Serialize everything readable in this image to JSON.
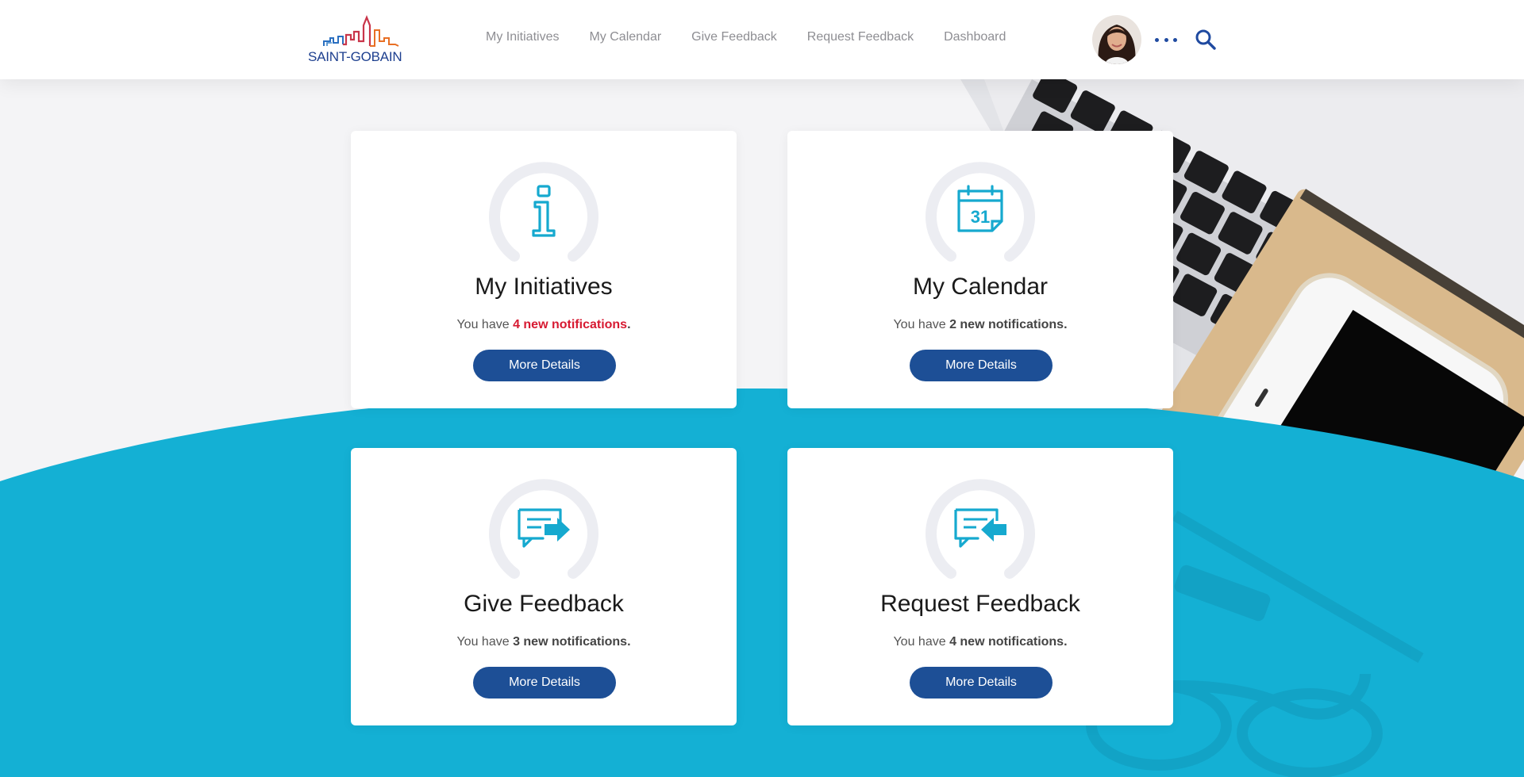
{
  "header": {
    "logo_text": "SAINT-GOBAIN",
    "nav": [
      "My Initiatives",
      "My Calendar",
      "Give Feedback",
      "Request Feedback",
      "Dashboard"
    ]
  },
  "cards": [
    {
      "title": "My Initiatives",
      "prefix": "You have ",
      "count_text": "4 new notifications",
      "suffix": ".",
      "button": "More Details",
      "icon": "info-icon",
      "highlight": true
    },
    {
      "title": "My Calendar",
      "prefix": "You have ",
      "count_text": "2 new notifications.",
      "suffix": "",
      "button": "More Details",
      "icon": "calendar-icon",
      "calendar_day": "31",
      "highlight": false
    },
    {
      "title": "Give Feedback",
      "prefix": "You have ",
      "count_text": "3 new notifications.",
      "suffix": "",
      "button": "More Details",
      "icon": "give-feedback-icon",
      "highlight": false
    },
    {
      "title": "Request Feedback",
      "prefix": "You have ",
      "count_text": "4 new notifications.",
      "suffix": "",
      "button": "More Details",
      "icon": "request-feedback-icon",
      "highlight": false
    }
  ],
  "colors": {
    "brand_blue": "#1d4f96",
    "accent_cyan": "#14b0d4",
    "alert_red": "#d71a32",
    "ring_grey": "#ecedf2",
    "icon_cyan": "#16a9cf"
  },
  "icons": {
    "more": "more-dots-icon",
    "search": "search-icon",
    "avatar": "user-avatar"
  }
}
